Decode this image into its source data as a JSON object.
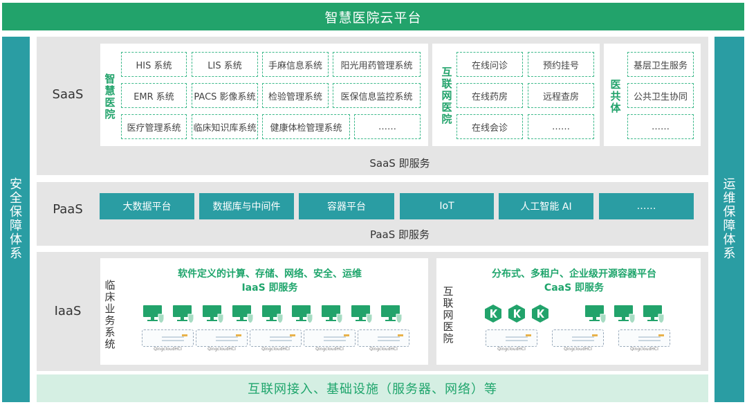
{
  "title": "智慧医院云平台",
  "left_sidebar": "安全保障体系",
  "right_sidebar": "运维保障体系",
  "saas": {
    "name": "SaaS",
    "caption": "SaaS 即服务",
    "smart_hospital": {
      "label": "智慧医院",
      "items": [
        "HIS 系统",
        "LIS 系统",
        "手麻信息系统",
        "阳光用药管理系统",
        "EMR 系统",
        "PACS 影像系统",
        "检验管理系统",
        "医保信息监控系统",
        "医疗管理系统",
        "临床知识库系统",
        "健康体检管理系统",
        "……"
      ]
    },
    "internet_hospital": {
      "label": "互联网医院",
      "items": [
        "在线问诊",
        "预约挂号",
        "在线药房",
        "远程查房",
        "在线会诊",
        "……"
      ]
    },
    "medical_community": {
      "label": "医共体",
      "items": [
        "基层卫生服务",
        "公共卫生协同",
        "……"
      ]
    }
  },
  "paas": {
    "name": "PaaS",
    "caption": "PaaS 即服务",
    "items": [
      "大数据平台",
      "数据库与中间件",
      "容器平台",
      "IoT",
      "人工智能 AI",
      "……"
    ]
  },
  "iaas": {
    "name": "IaaS",
    "clinical": {
      "label": "临床业务系统",
      "heading_line1": "软件定义的计算、存储、网络、安全、运维",
      "heading_line2": "IaaS 即服务",
      "server_label": "QingcloudHCI"
    },
    "internet": {
      "label": "互联网医院",
      "heading_line1": "分布式、多租户、企业级开源容器平台",
      "heading_line2": "CaaS 即服务",
      "server_label": "QingcloudHCI"
    }
  },
  "bottom": "互联网接入、基础设施（服务器、网络）等",
  "colors": {
    "green": "#22a36b",
    "teal": "#2a9da3",
    "light_green": "#d5efe3",
    "panel_gray": "#e5e5e5"
  }
}
